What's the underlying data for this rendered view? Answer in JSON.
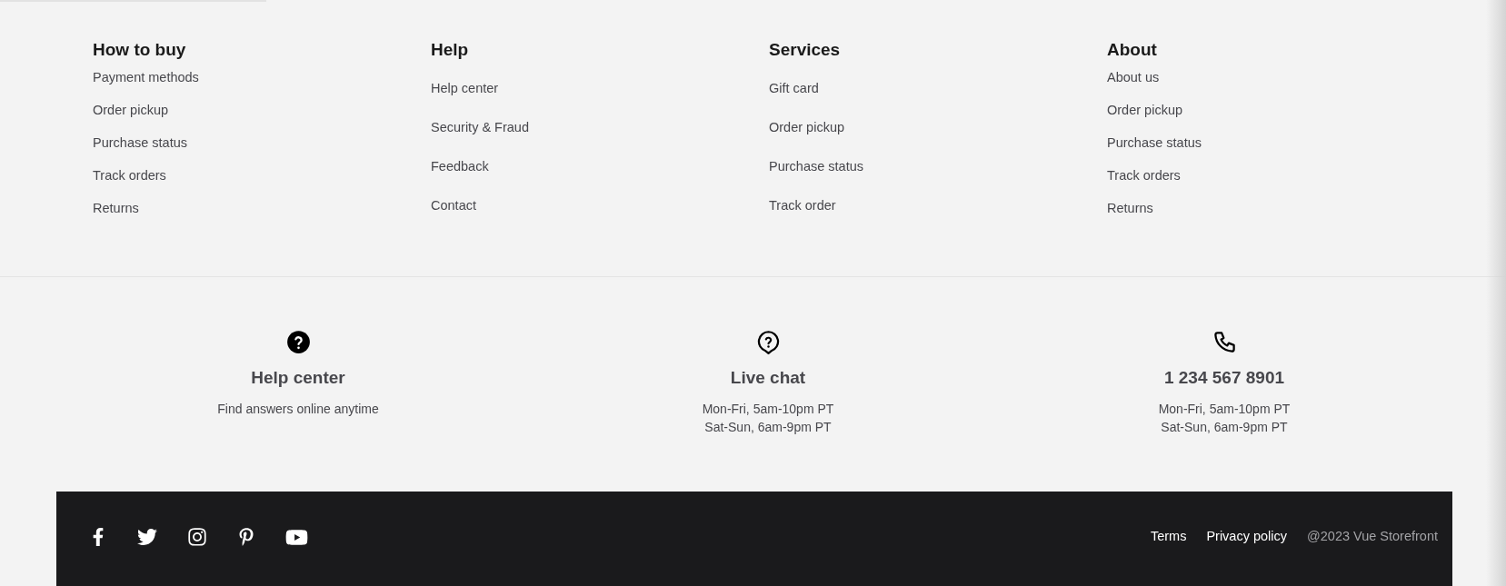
{
  "link_columns": [
    {
      "heading": "How to buy",
      "kind": "compact",
      "links": [
        "Payment methods",
        "Order pickup",
        "Purchase status",
        "Track orders",
        "Returns"
      ]
    },
    {
      "heading": "Help",
      "kind": "spaced",
      "links": [
        "Help center",
        "Security & Fraud",
        "Feedback",
        "Contact"
      ]
    },
    {
      "heading": "Services",
      "kind": "spaced",
      "links": [
        "Gift card",
        "Order pickup",
        "Purchase status",
        "Track order"
      ]
    },
    {
      "heading": "About",
      "kind": "compact",
      "links": [
        "About us",
        "Order pickup",
        "Purchase status",
        "Track orders",
        "Returns"
      ]
    }
  ],
  "contacts": [
    {
      "kind": "help",
      "title": "Help center",
      "lines": [
        "Find answers online anytime"
      ]
    },
    {
      "kind": "chat",
      "title": "Live chat",
      "lines": [
        "Mon-Fri, 5am-10pm PT",
        "Sat-Sun, 6am-9pm PT"
      ]
    },
    {
      "kind": "phone",
      "title": "1 234 567 8901",
      "lines": [
        "Mon-Fri, 5am-10pm PT",
        "Sat-Sun, 6am-9pm PT"
      ]
    }
  ],
  "bottom_bar": {
    "social": [
      {
        "kind": "facebook"
      },
      {
        "kind": "twitter"
      },
      {
        "kind": "instagram"
      },
      {
        "kind": "pinterest"
      },
      {
        "kind": "youtube"
      }
    ],
    "links": [
      "Terms",
      "Privacy policy"
    ],
    "copyright": "@2023 Vue Storefront"
  }
}
